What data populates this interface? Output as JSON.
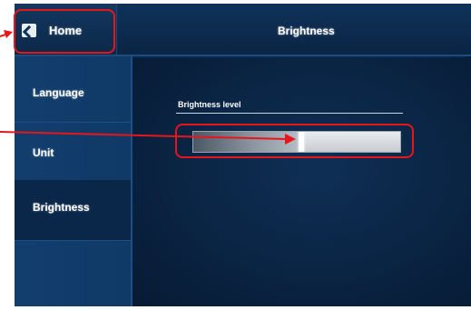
{
  "topbar": {
    "home_label": "Home",
    "title": "Brightness"
  },
  "sidebar": {
    "items": [
      {
        "label": "Language"
      },
      {
        "label": "Unit"
      },
      {
        "label": "Brightness",
        "selected": true
      }
    ]
  },
  "brightness": {
    "label": "Brightness level",
    "level_fraction": 0.52
  },
  "colors": {
    "annotation": "#e8151b",
    "screen_background": "#0b2747",
    "sidebar_background": "#123e6e"
  },
  "icons": {
    "home": "home-icon"
  }
}
